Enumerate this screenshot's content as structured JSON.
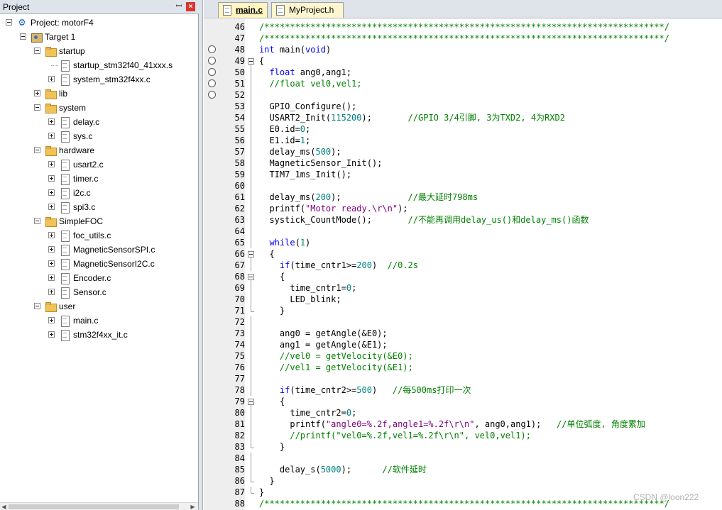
{
  "project_panel": {
    "title": "Project",
    "pin_glyph": "ꟷ",
    "close_glyph": "×",
    "tree": [
      {
        "label": "Project: motorF4",
        "level": 0,
        "kind": "project",
        "expanded": true
      },
      {
        "label": "Target 1",
        "level": 1,
        "kind": "target",
        "expanded": true
      },
      {
        "label": "startup",
        "level": 2,
        "kind": "folder",
        "expanded": true
      },
      {
        "label": "startup_stm32f40_41xxx.s",
        "level": 3,
        "kind": "file",
        "expander": false
      },
      {
        "label": "system_stm32f4xx.c",
        "level": 3,
        "kind": "file",
        "expander": true
      },
      {
        "label": "lib",
        "level": 2,
        "kind": "folder",
        "expanded": false
      },
      {
        "label": "system",
        "level": 2,
        "kind": "folder",
        "expanded": true
      },
      {
        "label": "delay.c",
        "level": 3,
        "kind": "file",
        "expander": true
      },
      {
        "label": "sys.c",
        "level": 3,
        "kind": "file",
        "expander": true
      },
      {
        "label": "hardware",
        "level": 2,
        "kind": "folder",
        "expanded": true
      },
      {
        "label": "usart2.c",
        "level": 3,
        "kind": "file",
        "expander": true
      },
      {
        "label": "timer.c",
        "level": 3,
        "kind": "file",
        "expander": true
      },
      {
        "label": "i2c.c",
        "level": 3,
        "kind": "file",
        "expander": true
      },
      {
        "label": "spi3.c",
        "level": 3,
        "kind": "file",
        "expander": true
      },
      {
        "label": "SimpleFOC",
        "level": 2,
        "kind": "folder",
        "expanded": true
      },
      {
        "label": "foc_utils.c",
        "level": 3,
        "kind": "file",
        "expander": true
      },
      {
        "label": "MagneticSensorSPI.c",
        "level": 3,
        "kind": "file",
        "expander": true
      },
      {
        "label": "MagneticSensorI2C.c",
        "level": 3,
        "kind": "file",
        "expander": true
      },
      {
        "label": "Encoder.c",
        "level": 3,
        "kind": "file",
        "expander": true
      },
      {
        "label": "Sensor.c",
        "level": 3,
        "kind": "file",
        "expander": true
      },
      {
        "label": "user",
        "level": 2,
        "kind": "folder",
        "expanded": true
      },
      {
        "label": "main.c",
        "level": 3,
        "kind": "file",
        "expander": true
      },
      {
        "label": "stm32f4xx_it.c",
        "level": 3,
        "kind": "file",
        "expander": true
      }
    ]
  },
  "tabs": [
    {
      "label": "main.c",
      "active": true
    },
    {
      "label": "MyProject.h",
      "active": false
    }
  ],
  "editor": {
    "breakpoint_lines": [
      48,
      49,
      50,
      51,
      52
    ],
    "lines": [
      {
        "n": "46",
        "fold": "",
        "segs": [
          [
            "cm",
            "/******************************************************************************/"
          ]
        ]
      },
      {
        "n": "47",
        "fold": "",
        "segs": [
          [
            "cm",
            "/******************************************************************************/"
          ]
        ]
      },
      {
        "n": "48",
        "fold": "",
        "segs": [
          [
            "kw",
            "int"
          ],
          [
            "",
            " main("
          ],
          [
            "kw",
            "void"
          ],
          [
            "",
            ")"
          ]
        ]
      },
      {
        "n": "49",
        "fold": "open",
        "segs": [
          [
            "",
            "{"
          ]
        ]
      },
      {
        "n": "50",
        "fold": "line",
        "segs": [
          [
            "",
            "  "
          ],
          [
            "kw",
            "float"
          ],
          [
            "",
            " ang0,ang1;"
          ]
        ]
      },
      {
        "n": "51",
        "fold": "line",
        "segs": [
          [
            "",
            "  "
          ],
          [
            "cm",
            "//float vel0,vel1;"
          ]
        ]
      },
      {
        "n": "52",
        "fold": "line",
        "segs": [
          [
            "",
            ""
          ]
        ]
      },
      {
        "n": "53",
        "fold": "line",
        "segs": [
          [
            "",
            "  GPIO_Configure();"
          ]
        ]
      },
      {
        "n": "54",
        "fold": "line",
        "segs": [
          [
            "",
            "  USART2_Init("
          ],
          [
            "nm",
            "115200"
          ],
          [
            "",
            ");       "
          ],
          [
            "cm",
            "//GPIO 3/4引脚, 3为TXD2, 4为RXD2"
          ]
        ]
      },
      {
        "n": "55",
        "fold": "line",
        "segs": [
          [
            "",
            "  E0.id="
          ],
          [
            "nm",
            "0"
          ],
          [
            "",
            ";"
          ]
        ]
      },
      {
        "n": "56",
        "fold": "line",
        "segs": [
          [
            "",
            "  E1.id="
          ],
          [
            "nm",
            "1"
          ],
          [
            "",
            ";"
          ]
        ]
      },
      {
        "n": "57",
        "fold": "line",
        "segs": [
          [
            "",
            "  delay_ms("
          ],
          [
            "nm",
            "500"
          ],
          [
            "",
            ");"
          ]
        ]
      },
      {
        "n": "58",
        "fold": "line",
        "segs": [
          [
            "",
            "  MagneticSensor_Init();"
          ]
        ]
      },
      {
        "n": "59",
        "fold": "line",
        "segs": [
          [
            "",
            "  TIM7_1ms_Init();"
          ]
        ]
      },
      {
        "n": "60",
        "fold": "line",
        "segs": [
          [
            "",
            ""
          ]
        ]
      },
      {
        "n": "61",
        "fold": "line",
        "segs": [
          [
            "",
            "  delay_ms("
          ],
          [
            "nm",
            "200"
          ],
          [
            "",
            ");             "
          ],
          [
            "cm",
            "//最大延时798ms"
          ]
        ]
      },
      {
        "n": "62",
        "fold": "line",
        "segs": [
          [
            "",
            "  printf("
          ],
          [
            "st",
            "\"Motor ready.\\r\\n\""
          ],
          [
            "",
            ");"
          ]
        ]
      },
      {
        "n": "63",
        "fold": "line",
        "segs": [
          [
            "",
            "  systick_CountMode();       "
          ],
          [
            "cm",
            "//不能再调用delay_us()和delay_ms()函数"
          ]
        ]
      },
      {
        "n": "64",
        "fold": "line",
        "segs": [
          [
            "",
            ""
          ]
        ]
      },
      {
        "n": "65",
        "fold": "line",
        "segs": [
          [
            "",
            "  "
          ],
          [
            "kw",
            "while"
          ],
          [
            "",
            "("
          ],
          [
            "nm",
            "1"
          ],
          [
            "",
            ")"
          ]
        ]
      },
      {
        "n": "66",
        "fold": "open",
        "segs": [
          [
            "",
            "  {"
          ]
        ]
      },
      {
        "n": "67",
        "fold": "line",
        "segs": [
          [
            "",
            "    "
          ],
          [
            "kw",
            "if"
          ],
          [
            "",
            "(time_cntr1>="
          ],
          [
            "nm",
            "200"
          ],
          [
            "",
            ")  "
          ],
          [
            "cm",
            "//0.2s"
          ]
        ]
      },
      {
        "n": "68",
        "fold": "open",
        "segs": [
          [
            "",
            "    {"
          ]
        ]
      },
      {
        "n": "69",
        "fold": "line",
        "segs": [
          [
            "",
            "      time_cntr1="
          ],
          [
            "nm",
            "0"
          ],
          [
            "",
            ";"
          ]
        ]
      },
      {
        "n": "70",
        "fold": "line",
        "segs": [
          [
            "",
            "      LED_blink;"
          ]
        ]
      },
      {
        "n": "71",
        "fold": "end",
        "segs": [
          [
            "",
            "    }"
          ]
        ]
      },
      {
        "n": "72",
        "fold": "line",
        "segs": [
          [
            "",
            ""
          ]
        ]
      },
      {
        "n": "73",
        "fold": "line",
        "segs": [
          [
            "",
            "    ang0 = getAngle(&E0);"
          ]
        ]
      },
      {
        "n": "74",
        "fold": "line",
        "segs": [
          [
            "",
            "    ang1 = getAngle(&E1);"
          ]
        ]
      },
      {
        "n": "75",
        "fold": "line",
        "segs": [
          [
            "",
            "    "
          ],
          [
            "cm",
            "//vel0 = getVelocity(&E0);"
          ]
        ]
      },
      {
        "n": "76",
        "fold": "line",
        "segs": [
          [
            "",
            "    "
          ],
          [
            "cm",
            "//vel1 = getVelocity(&E1);"
          ]
        ]
      },
      {
        "n": "77",
        "fold": "line",
        "segs": [
          [
            "",
            ""
          ]
        ]
      },
      {
        "n": "78",
        "fold": "line",
        "segs": [
          [
            "",
            "    "
          ],
          [
            "kw",
            "if"
          ],
          [
            "",
            "(time_cntr2>="
          ],
          [
            "nm",
            "500"
          ],
          [
            "",
            ")   "
          ],
          [
            "cm",
            "//每500ms打印一次"
          ]
        ]
      },
      {
        "n": "79",
        "fold": "open",
        "segs": [
          [
            "",
            "    {"
          ]
        ]
      },
      {
        "n": "80",
        "fold": "line",
        "segs": [
          [
            "",
            "      time_cntr2="
          ],
          [
            "nm",
            "0"
          ],
          [
            "",
            ";"
          ]
        ]
      },
      {
        "n": "81",
        "fold": "line",
        "segs": [
          [
            "",
            "      printf("
          ],
          [
            "st",
            "\"angle0=%.2f,angle1=%.2f\\r\\n\""
          ],
          [
            "",
            ", ang0,ang1);   "
          ],
          [
            "cm",
            "//单位弧度, 角度累加"
          ]
        ]
      },
      {
        "n": "82",
        "fold": "line",
        "segs": [
          [
            "",
            "      "
          ],
          [
            "cm",
            "//printf(\"vel0=%.2f,vel1=%.2f\\r\\n\", vel0,vel1);"
          ]
        ]
      },
      {
        "n": "83",
        "fold": "end",
        "segs": [
          [
            "",
            "    }"
          ]
        ]
      },
      {
        "n": "84",
        "fold": "line",
        "segs": [
          [
            "",
            ""
          ]
        ]
      },
      {
        "n": "85",
        "fold": "line",
        "segs": [
          [
            "",
            "    delay_s("
          ],
          [
            "nm",
            "5000"
          ],
          [
            "",
            ");      "
          ],
          [
            "cm",
            "//软件延时"
          ]
        ]
      },
      {
        "n": "86",
        "fold": "end",
        "segs": [
          [
            "",
            "  }"
          ]
        ]
      },
      {
        "n": "87",
        "fold": "end",
        "segs": [
          [
            "",
            "}"
          ]
        ]
      },
      {
        "n": "88",
        "fold": "",
        "segs": [
          [
            "cm",
            "/******************************************************************************/"
          ]
        ]
      }
    ]
  },
  "watermark": "CSDN @loon222"
}
